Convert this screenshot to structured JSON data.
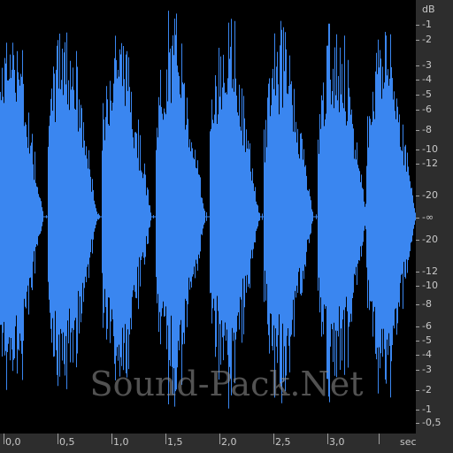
{
  "colors": {
    "waveform": "#3a86f0",
    "background": "#000000",
    "ruler_background": "#2d2d2d",
    "ruler_text": "#c8c8c8"
  },
  "watermark": "Sound-Pack.Net",
  "db_scale": {
    "unit": "dB",
    "labels": [
      "-1",
      "-2",
      "-3",
      "-4",
      "-5",
      "-6",
      "-8",
      "-10",
      "-12",
      "-20",
      "-∞",
      "-20",
      "-12",
      "-10",
      "-8",
      "-6",
      "-5",
      "-4",
      "-3",
      "-2",
      "-1",
      "-0,5"
    ]
  },
  "time_scale": {
    "unit": "sec",
    "labels": [
      "0,0",
      "0,5",
      "1,0",
      "1,5",
      "2,0",
      "2,5",
      "3,0"
    ]
  },
  "waveform": {
    "bursts_seconds": [
      0.0,
      0.5,
      1.0,
      1.5,
      2.0,
      2.5,
      3.0,
      3.45
    ]
  }
}
